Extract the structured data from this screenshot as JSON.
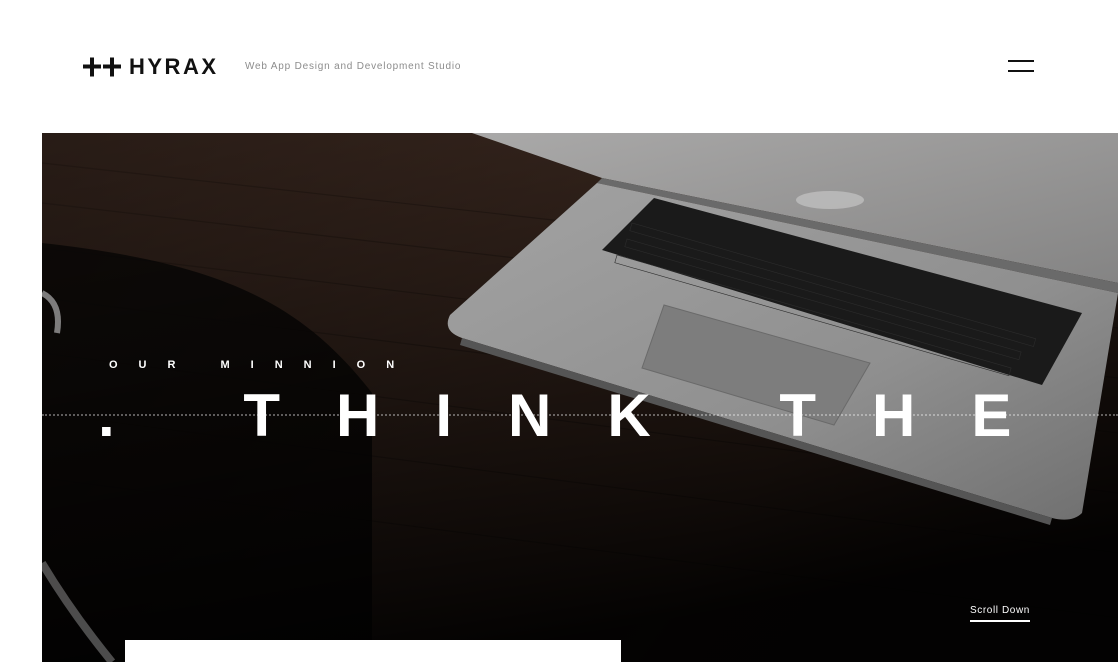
{
  "header": {
    "logo_text": "HYRAX",
    "tagline": "Web App Design and Development Studio",
    "menu_icon": "hamburger-icon"
  },
  "hero": {
    "eyebrow": "OUR MINNION",
    "headline": "E. THINK THE",
    "scroll_label": "Scroll Down",
    "background": "laptop-on-wooden-desk-photo"
  },
  "colors": {
    "ink": "#111111",
    "tagline": "#8c8c8c",
    "hero_dark": "#0c0a09",
    "wood": "#3a2820",
    "laptop": "#8e8e8e"
  }
}
